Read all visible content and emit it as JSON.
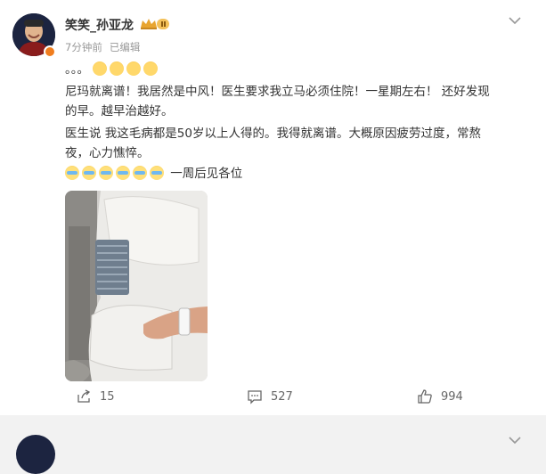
{
  "post": {
    "user_name": "笑笑_孙亚龙",
    "time": "7分钟前",
    "edited": "已编辑",
    "vip_badge_icon": "vip-crown-badge",
    "text_line1_prefix": "。。。",
    "text_line2": "尼玛就离谱！我居然是中风！医生要求我立马必须住院！一星期左右！ 还好发现",
    "text_line3": "的早。越早治越好。",
    "text_line4": "医生说 我这毛病都是50岁以上人得的。我得就离谱。大概原因疲劳过度，常熬",
    "text_line5": "夜，心力憔悴。",
    "text_line6_suffix": "一周后见各位",
    "emojis": {
      "laugh_count": 4,
      "laugh_icon": "laugh-cry-emoji",
      "cry_count": 6,
      "cry_icon": "crying-emoji"
    }
  },
  "actions": {
    "repost_count": "15",
    "comment_count": "527",
    "like_count": "994",
    "repost_icon": "share-icon",
    "comment_icon": "comment-icon",
    "like_icon": "thumbs-up-icon"
  },
  "colors": {
    "text": "#333333",
    "meta": "#999999",
    "verified_badge": "#f07d1e",
    "background": "#f2f2f2"
  }
}
